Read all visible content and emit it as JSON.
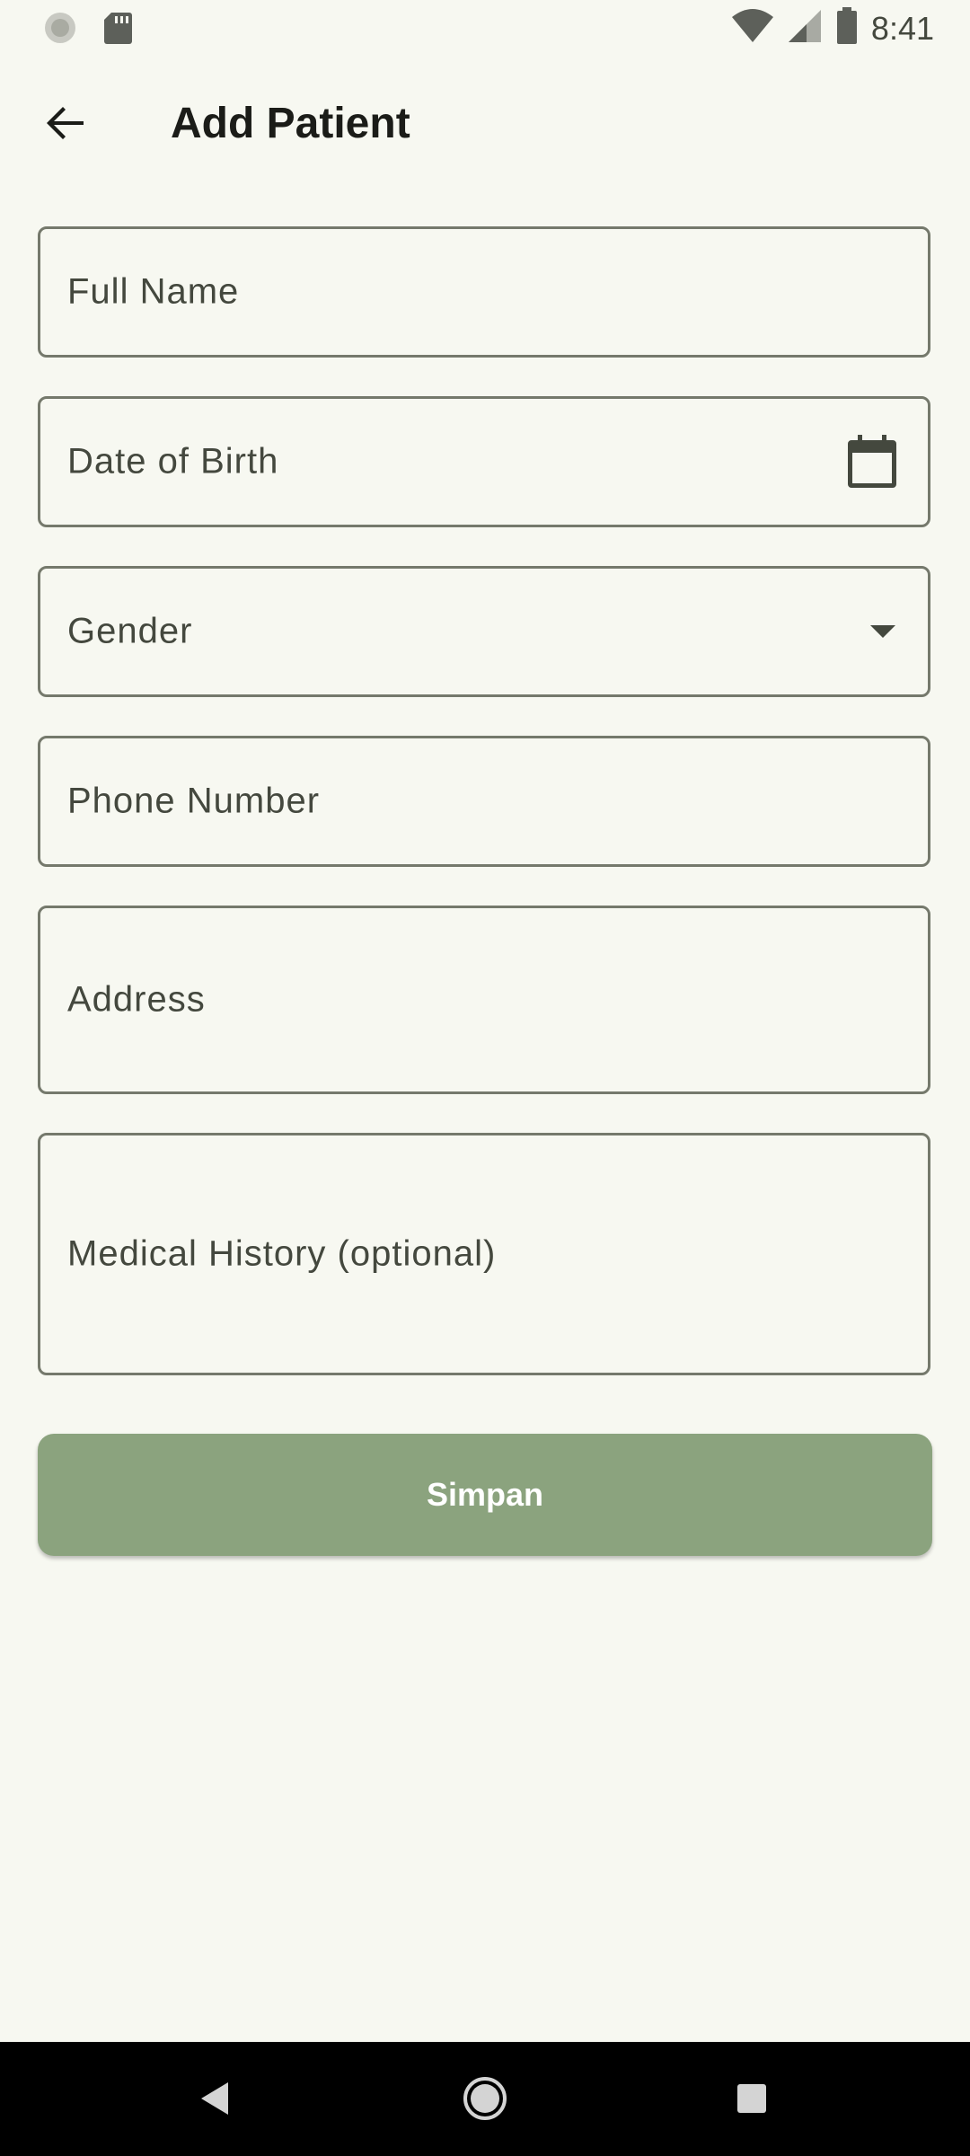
{
  "status_bar": {
    "time": "8:41",
    "left_icons": [
      "loading-circle-icon",
      "sd-card-icon"
    ],
    "right_icons": [
      "wifi-icon",
      "signal-icon",
      "battery-icon"
    ]
  },
  "app_bar": {
    "title": "Add Patient",
    "back_icon": "arrow-back-icon"
  },
  "form": {
    "full_name": {
      "label": "Full Name",
      "value": ""
    },
    "date_of_birth": {
      "label": "Date of Birth",
      "value": "",
      "icon": "calendar-icon"
    },
    "gender": {
      "label": "Gender",
      "value": "",
      "icon": "dropdown-arrow-icon"
    },
    "phone_number": {
      "label": "Phone Number",
      "value": ""
    },
    "address": {
      "label": "Address",
      "value": ""
    },
    "medical_history": {
      "label": "Medical History (optional)",
      "value": ""
    },
    "save_label": "Simpan"
  },
  "nav_bar": {
    "buttons": [
      "back-triangle-icon",
      "home-circle-icon",
      "recents-square-icon"
    ]
  },
  "colors": {
    "background": "#f7f8f1",
    "outline": "#75796c",
    "button": "#8ba37e",
    "text": "#1b1c18",
    "label": "#44483e",
    "nav_background": "#000000"
  }
}
